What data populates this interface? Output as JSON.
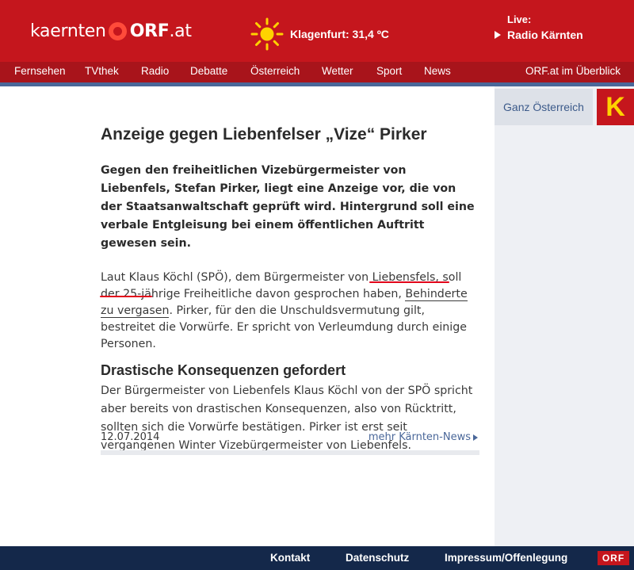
{
  "header": {
    "logo": {
      "region": "kaernten",
      "brand": "ORF",
      "suffix": ".at"
    },
    "weather": {
      "icon": "sun-icon",
      "text": "Klagenfurt: 31,4 ºC"
    },
    "live": {
      "label": "Live:",
      "station": "Radio Kärnten"
    }
  },
  "nav": {
    "items": [
      "Fernsehen",
      "TVthek",
      "Radio",
      "Debatte",
      "Österreich",
      "Wetter",
      "Sport",
      "News"
    ],
    "overview": "ORF.at im Überblick"
  },
  "sidebar": {
    "ganz_label": "Ganz Österreich",
    "badge": "K"
  },
  "article": {
    "title": "Anzeige gegen Liebenfelser „Vize“ Pirker",
    "lead": "Gegen den freiheitlichen Vizebürgermeister von Liebenfels, Stefan Pirker, liegt eine Anzeige vor, die von der Staatsanwaltschaft geprüft wird. Hintergrund soll eine verbale Entgleisung bei einem öffentlichen Auftritt gewesen sein.",
    "p1_before": "Laut Klaus Köchl (SPÖ), dem Bürgermeister von Liebensfels, soll der 25-jährige Freiheitliche davon gesprochen haben, ",
    "p1_highlight": "Behinderte zu vergasen",
    "p1_after": ". Pirker, für den die Unschuldsvermutung gilt, bestreitet die Vorwürfe. Er spricht von Verleumdung durch einige Personen.",
    "subheading": "Drastische Konsequenzen gefordert",
    "p2": "Der Bürgermeister von Liebenfels Klaus Köchl von der SPÖ spricht aber bereits von drastischen Konsequenzen, also von Rücktritt, sollten sich die Vorwürfe bestätigen. Pirker ist erst seit vergangenen Winter Vizebürgermeister von Liebenfels.",
    "date": "12.07.2014",
    "more_link": "mehr Kärnten-News"
  },
  "colors": {
    "header_red": "#c5161d",
    "nav_red": "#a8141b",
    "accent_blue": "#4a6799",
    "footer_navy": "#14284a",
    "annotation_red": "#e2001a",
    "k_yellow": "#ffd200"
  },
  "footer": {
    "links": [
      "Kontakt",
      "Datenschutz",
      "Impressum/Offenlegung"
    ],
    "badge": "ORF"
  }
}
